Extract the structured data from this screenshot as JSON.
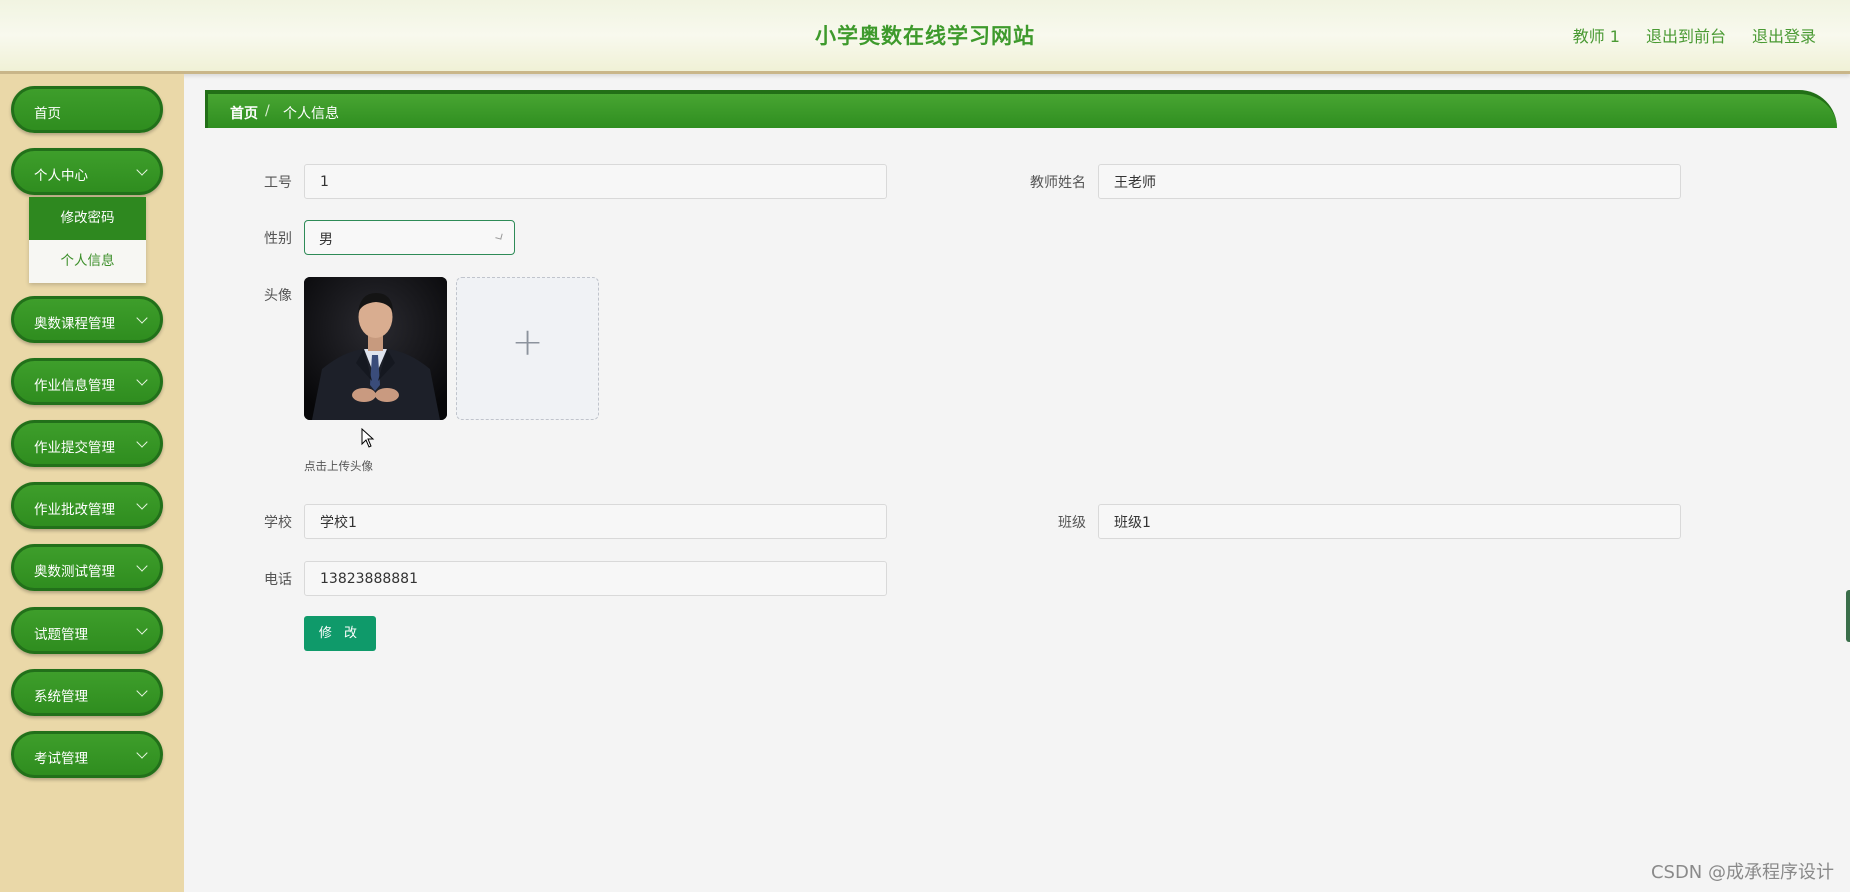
{
  "header": {
    "title": "小学奥数在线学习网站",
    "links": [
      "教师 1",
      "退出到前台",
      "退出登录"
    ]
  },
  "sidebar": {
    "items": [
      {
        "label": "首页",
        "chevron": false
      },
      {
        "label": "个人中心",
        "chevron": true,
        "expanded": true
      },
      {
        "label": "奥数课程管理",
        "chevron": true
      },
      {
        "label": "作业信息管理",
        "chevron": true
      },
      {
        "label": "作业提交管理",
        "chevron": true
      },
      {
        "label": "作业批改管理",
        "chevron": true
      },
      {
        "label": "奥数测试管理",
        "chevron": true
      },
      {
        "label": "试题管理",
        "chevron": true
      },
      {
        "label": "系统管理",
        "chevron": true
      },
      {
        "label": "考试管理",
        "chevron": true
      }
    ],
    "submenu": [
      {
        "label": "修改密码",
        "active": true
      },
      {
        "label": "个人信息",
        "active": false
      }
    ]
  },
  "breadcrumb": {
    "home": "首页",
    "separator": "/",
    "current": "个人信息"
  },
  "form": {
    "employee_id": {
      "label": "工号",
      "value": "1"
    },
    "teacher_name": {
      "label": "教师姓名",
      "value": "王老师"
    },
    "gender": {
      "label": "性别",
      "value": "男"
    },
    "avatar": {
      "label": "头像",
      "upload_tip": "点击上传头像",
      "upload_icon": "plus-icon"
    },
    "school": {
      "label": "学校",
      "value": "学校1"
    },
    "class": {
      "label": "班级",
      "value": "班级1"
    },
    "phone": {
      "label": "电话",
      "value": "13823888881"
    },
    "submit_label": "修 改"
  },
  "watermark": "CSDN @成承程序设计",
  "colors": {
    "brand_green": "#3e9a2c",
    "sidebar_bg": "#ead8a8",
    "submit": "#0f9a6a"
  }
}
